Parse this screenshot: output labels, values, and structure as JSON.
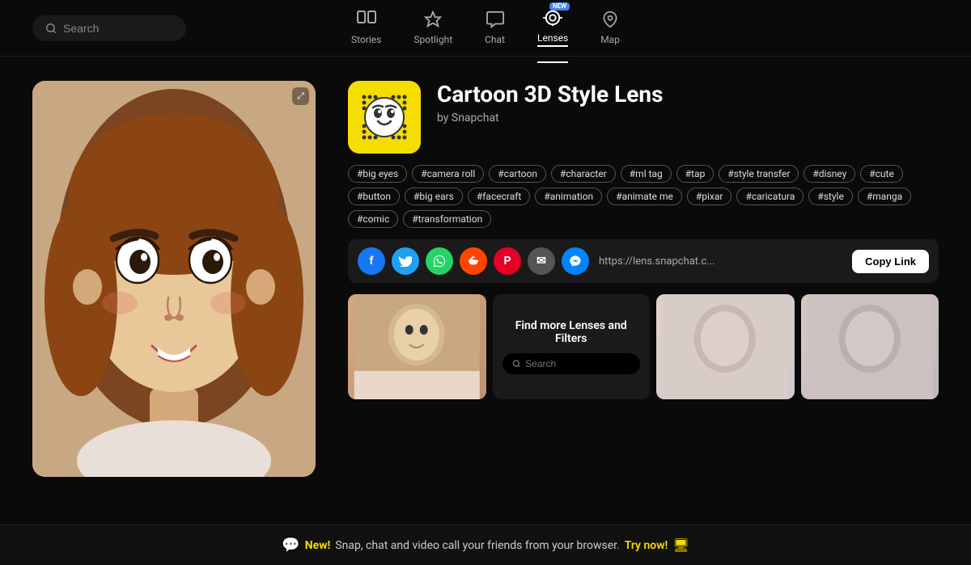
{
  "header": {
    "search_placeholder": "Search",
    "nav": [
      {
        "id": "stories",
        "label": "Stories",
        "icon": "stories",
        "active": false,
        "new": false
      },
      {
        "id": "spotlight",
        "label": "Spotlight",
        "icon": "spotlight",
        "active": false,
        "new": false
      },
      {
        "id": "chat",
        "label": "Chat",
        "icon": "chat",
        "active": false,
        "new": false
      },
      {
        "id": "lenses",
        "label": "Lenses",
        "icon": "lenses",
        "active": true,
        "new": true
      },
      {
        "id": "map",
        "label": "Map",
        "icon": "map",
        "active": false,
        "new": false
      }
    ]
  },
  "lens": {
    "title": "Cartoon 3D Style Lens",
    "author": "by Snapchat",
    "tags": [
      "#big eyes",
      "#camera roll",
      "#cartoon",
      "#character",
      "#ml tag",
      "#tap",
      "#style transfer",
      "#disney",
      "#cute",
      "#button",
      "#big ears",
      "#facecraft",
      "#animation",
      "#animate me",
      "#pixar",
      "#caricatura",
      "#style",
      "#manga",
      "#comic",
      "#transformation"
    ],
    "link": "https://lens.snapchat.c...",
    "copy_label": "Copy Link",
    "new_badge": "NEW"
  },
  "find_more": {
    "title": "Find more Lenses and Filters",
    "search_placeholder": "Search"
  },
  "share": {
    "platforms": [
      "Facebook",
      "Twitter",
      "WhatsApp",
      "Reddit",
      "Pinterest",
      "Email",
      "Messenger"
    ]
  },
  "banner": {
    "new_label": "New!",
    "text": "Snap, chat and video call your friends from your browser.",
    "cta": "Try now!"
  }
}
